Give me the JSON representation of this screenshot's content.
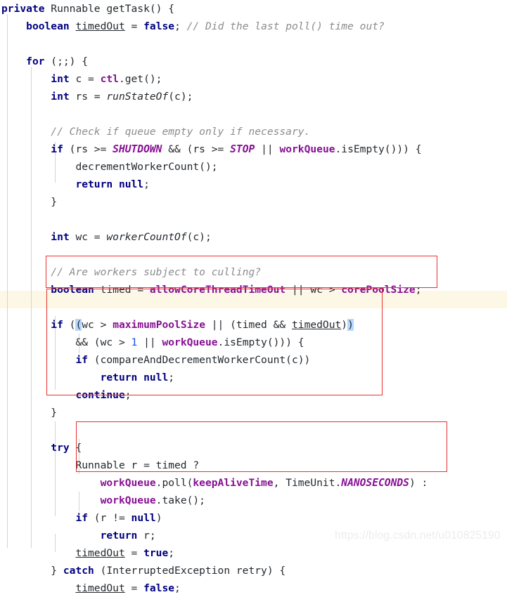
{
  "editor": {
    "language": "Java",
    "method_signature": "private Runnable getTask() {",
    "colors": {
      "background": "#ffffff",
      "keyword": "#000080",
      "field": "#871094",
      "comment": "#8c8c8c",
      "number": "#1750eb",
      "plain_text": "#24292e",
      "caret_row_highlight": "#fdf8e6",
      "bracket_match_highlight": "#b4d7ff",
      "annotation_box": "#e8312f",
      "indent_guide": "#d4d4d4",
      "watermark": "#ececec"
    }
  },
  "watermark": {
    "text": "https://blog.csdn.net/u010825190"
  },
  "annotations": {
    "boxes": [
      {
        "label": "timed-assignment-box",
        "line_start": 15,
        "line_end": 15
      },
      {
        "label": "worker-culling-if-box",
        "line_start": 16,
        "line_end": 22
      },
      {
        "label": "poll-vs-take-box",
        "line_start": 24,
        "line_end": 26
      }
    ],
    "caret_line": 16
  },
  "code": {
    "lines": [
      {
        "n": 1,
        "indent": 0,
        "tokens": [
          {
            "t": "private",
            "c": "kw"
          },
          {
            "t": " Runnable getTask() {",
            "c": "plain"
          }
        ]
      },
      {
        "n": 2,
        "indent": 1,
        "tokens": [
          {
            "t": "boolean",
            "c": "kw"
          },
          {
            "t": " ",
            "c": "plain"
          },
          {
            "t": "timedOut",
            "c": "localvar"
          },
          {
            "t": " = ",
            "c": "plain"
          },
          {
            "t": "false",
            "c": "kw"
          },
          {
            "t": "; ",
            "c": "plain"
          },
          {
            "t": "// Did the last poll() time out?",
            "c": "cmt"
          }
        ]
      },
      {
        "n": 3,
        "indent": 1,
        "tokens": []
      },
      {
        "n": 4,
        "indent": 1,
        "tokens": [
          {
            "t": "for",
            "c": "kw"
          },
          {
            "t": " (;;) {",
            "c": "plain"
          }
        ]
      },
      {
        "n": 5,
        "indent": 2,
        "tokens": [
          {
            "t": "int",
            "c": "kw"
          },
          {
            "t": " c = ",
            "c": "plain"
          },
          {
            "t": "ctl",
            "c": "field"
          },
          {
            "t": ".get();",
            "c": "plain"
          }
        ]
      },
      {
        "n": 6,
        "indent": 2,
        "tokens": [
          {
            "t": "int",
            "c": "kw"
          },
          {
            "t": " rs = ",
            "c": "plain"
          },
          {
            "t": "runStateOf",
            "c": "staticm"
          },
          {
            "t": "(c);",
            "c": "plain"
          }
        ]
      },
      {
        "n": 7,
        "indent": 2,
        "tokens": []
      },
      {
        "n": 8,
        "indent": 2,
        "tokens": [
          {
            "t": "// Check if queue empty only if necessary.",
            "c": "cmt"
          }
        ]
      },
      {
        "n": 9,
        "indent": 2,
        "tokens": [
          {
            "t": "if",
            "c": "kw"
          },
          {
            "t": " (rs >= ",
            "c": "plain"
          },
          {
            "t": "SHUTDOWN",
            "c": "static"
          },
          {
            "t": " && (rs >= ",
            "c": "plain"
          },
          {
            "t": "STOP",
            "c": "static"
          },
          {
            "t": " || ",
            "c": "plain"
          },
          {
            "t": "workQueue",
            "c": "field"
          },
          {
            "t": ".isEmpty())) {",
            "c": "plain"
          }
        ]
      },
      {
        "n": 10,
        "indent": 3,
        "tokens": [
          {
            "t": "decrementWorkerCount();",
            "c": "plain"
          }
        ]
      },
      {
        "n": 11,
        "indent": 3,
        "tokens": [
          {
            "t": "return",
            "c": "kw"
          },
          {
            "t": " ",
            "c": "plain"
          },
          {
            "t": "null",
            "c": "kw"
          },
          {
            "t": ";",
            "c": "plain"
          }
        ]
      },
      {
        "n": 12,
        "indent": 2,
        "tokens": [
          {
            "t": "}",
            "c": "plain"
          }
        ]
      },
      {
        "n": 13,
        "indent": 2,
        "tokens": []
      },
      {
        "n": 14,
        "indent": 2,
        "tokens": [
          {
            "t": "int",
            "c": "kw"
          },
          {
            "t": " wc = ",
            "c": "plain"
          },
          {
            "t": "workerCountOf",
            "c": "staticm"
          },
          {
            "t": "(c);",
            "c": "plain"
          }
        ]
      },
      {
        "n": 15,
        "indent": 2,
        "tokens": []
      },
      {
        "n": 16,
        "indent": 2,
        "tokens": [
          {
            "t": "// Are workers subject to culling?",
            "c": "cmt"
          }
        ]
      },
      {
        "n": 17,
        "indent": 2,
        "tokens": [
          {
            "t": "boolean",
            "c": "kw"
          },
          {
            "t": " timed = ",
            "c": "plain"
          },
          {
            "t": "allowCoreThreadTimeOut",
            "c": "field"
          },
          {
            "t": " || wc > ",
            "c": "plain"
          },
          {
            "t": "corePoolSize",
            "c": "field"
          },
          {
            "t": ";",
            "c": "plain"
          }
        ]
      },
      {
        "n": 18,
        "indent": 2,
        "tokens": []
      },
      {
        "n": 19,
        "indent": 2,
        "tokens": [
          {
            "t": "if",
            "c": "kw"
          },
          {
            "t": " (",
            "c": "plain"
          },
          {
            "t": "(",
            "c": "brkmatch"
          },
          {
            "t": "wc > ",
            "c": "plain"
          },
          {
            "t": "maximumPoolSize",
            "c": "field"
          },
          {
            "t": " || (timed && ",
            "c": "plain"
          },
          {
            "t": "timedOut",
            "c": "localvar"
          },
          {
            "t": ")",
            "c": "plain"
          },
          {
            "t": ")",
            "c": "brkmatch"
          }
        ]
      },
      {
        "n": 20,
        "indent": 3,
        "tokens": [
          {
            "t": "&& (wc > ",
            "c": "plain"
          },
          {
            "t": "1",
            "c": "num"
          },
          {
            "t": " || ",
            "c": "plain"
          },
          {
            "t": "workQueue",
            "c": "field"
          },
          {
            "t": ".isEmpty())) {",
            "c": "plain"
          }
        ]
      },
      {
        "n": 21,
        "indent": 3,
        "tokens": [
          {
            "t": "if",
            "c": "kw"
          },
          {
            "t": " (compareAndDecrementWorkerCount(c))",
            "c": "plain"
          }
        ]
      },
      {
        "n": 22,
        "indent": 4,
        "tokens": [
          {
            "t": "return",
            "c": "kw"
          },
          {
            "t": " ",
            "c": "plain"
          },
          {
            "t": "null",
            "c": "kw"
          },
          {
            "t": ";",
            "c": "plain"
          }
        ]
      },
      {
        "n": 23,
        "indent": 3,
        "tokens": [
          {
            "t": "continue",
            "c": "kw"
          },
          {
            "t": ";",
            "c": "plain"
          }
        ]
      },
      {
        "n": 24,
        "indent": 2,
        "tokens": [
          {
            "t": "}",
            "c": "plain"
          }
        ]
      },
      {
        "n": 25,
        "indent": 2,
        "tokens": []
      },
      {
        "n": 26,
        "indent": 2,
        "tokens": [
          {
            "t": "try",
            "c": "kw"
          },
          {
            "t": " {",
            "c": "plain"
          }
        ]
      },
      {
        "n": 27,
        "indent": 3,
        "tokens": [
          {
            "t": "Runnable r = timed ?",
            "c": "plain"
          }
        ]
      },
      {
        "n": 28,
        "indent": 4,
        "tokens": [
          {
            "t": "workQueue",
            "c": "field"
          },
          {
            "t": ".poll(",
            "c": "plain"
          },
          {
            "t": "keepAliveTime",
            "c": "field"
          },
          {
            "t": ", TimeUnit.",
            "c": "plain"
          },
          {
            "t": "NANOSECONDS",
            "c": "static"
          },
          {
            "t": ") :",
            "c": "plain"
          }
        ]
      },
      {
        "n": 29,
        "indent": 4,
        "tokens": [
          {
            "t": "workQueue",
            "c": "field"
          },
          {
            "t": ".take();",
            "c": "plain"
          }
        ]
      },
      {
        "n": 30,
        "indent": 3,
        "tokens": [
          {
            "t": "if",
            "c": "kw"
          },
          {
            "t": " (r != ",
            "c": "plain"
          },
          {
            "t": "null",
            "c": "kw"
          },
          {
            "t": ")",
            "c": "plain"
          }
        ]
      },
      {
        "n": 31,
        "indent": 4,
        "tokens": [
          {
            "t": "return",
            "c": "kw"
          },
          {
            "t": " r;",
            "c": "plain"
          }
        ]
      },
      {
        "n": 32,
        "indent": 3,
        "tokens": [
          {
            "t": "timedOut",
            "c": "localvar"
          },
          {
            "t": " = ",
            "c": "plain"
          },
          {
            "t": "true",
            "c": "kw"
          },
          {
            "t": ";",
            "c": "plain"
          }
        ]
      },
      {
        "n": 33,
        "indent": 2,
        "tokens": [
          {
            "t": "} ",
            "c": "plain"
          },
          {
            "t": "catch",
            "c": "kw"
          },
          {
            "t": " (InterruptedException retry) {",
            "c": "plain"
          }
        ]
      },
      {
        "n": 34,
        "indent": 3,
        "tokens": [
          {
            "t": "timedOut",
            "c": "localvar"
          },
          {
            "t": " = ",
            "c": "plain"
          },
          {
            "t": "false",
            "c": "kw"
          },
          {
            "t": ";",
            "c": "plain"
          }
        ]
      }
    ]
  }
}
